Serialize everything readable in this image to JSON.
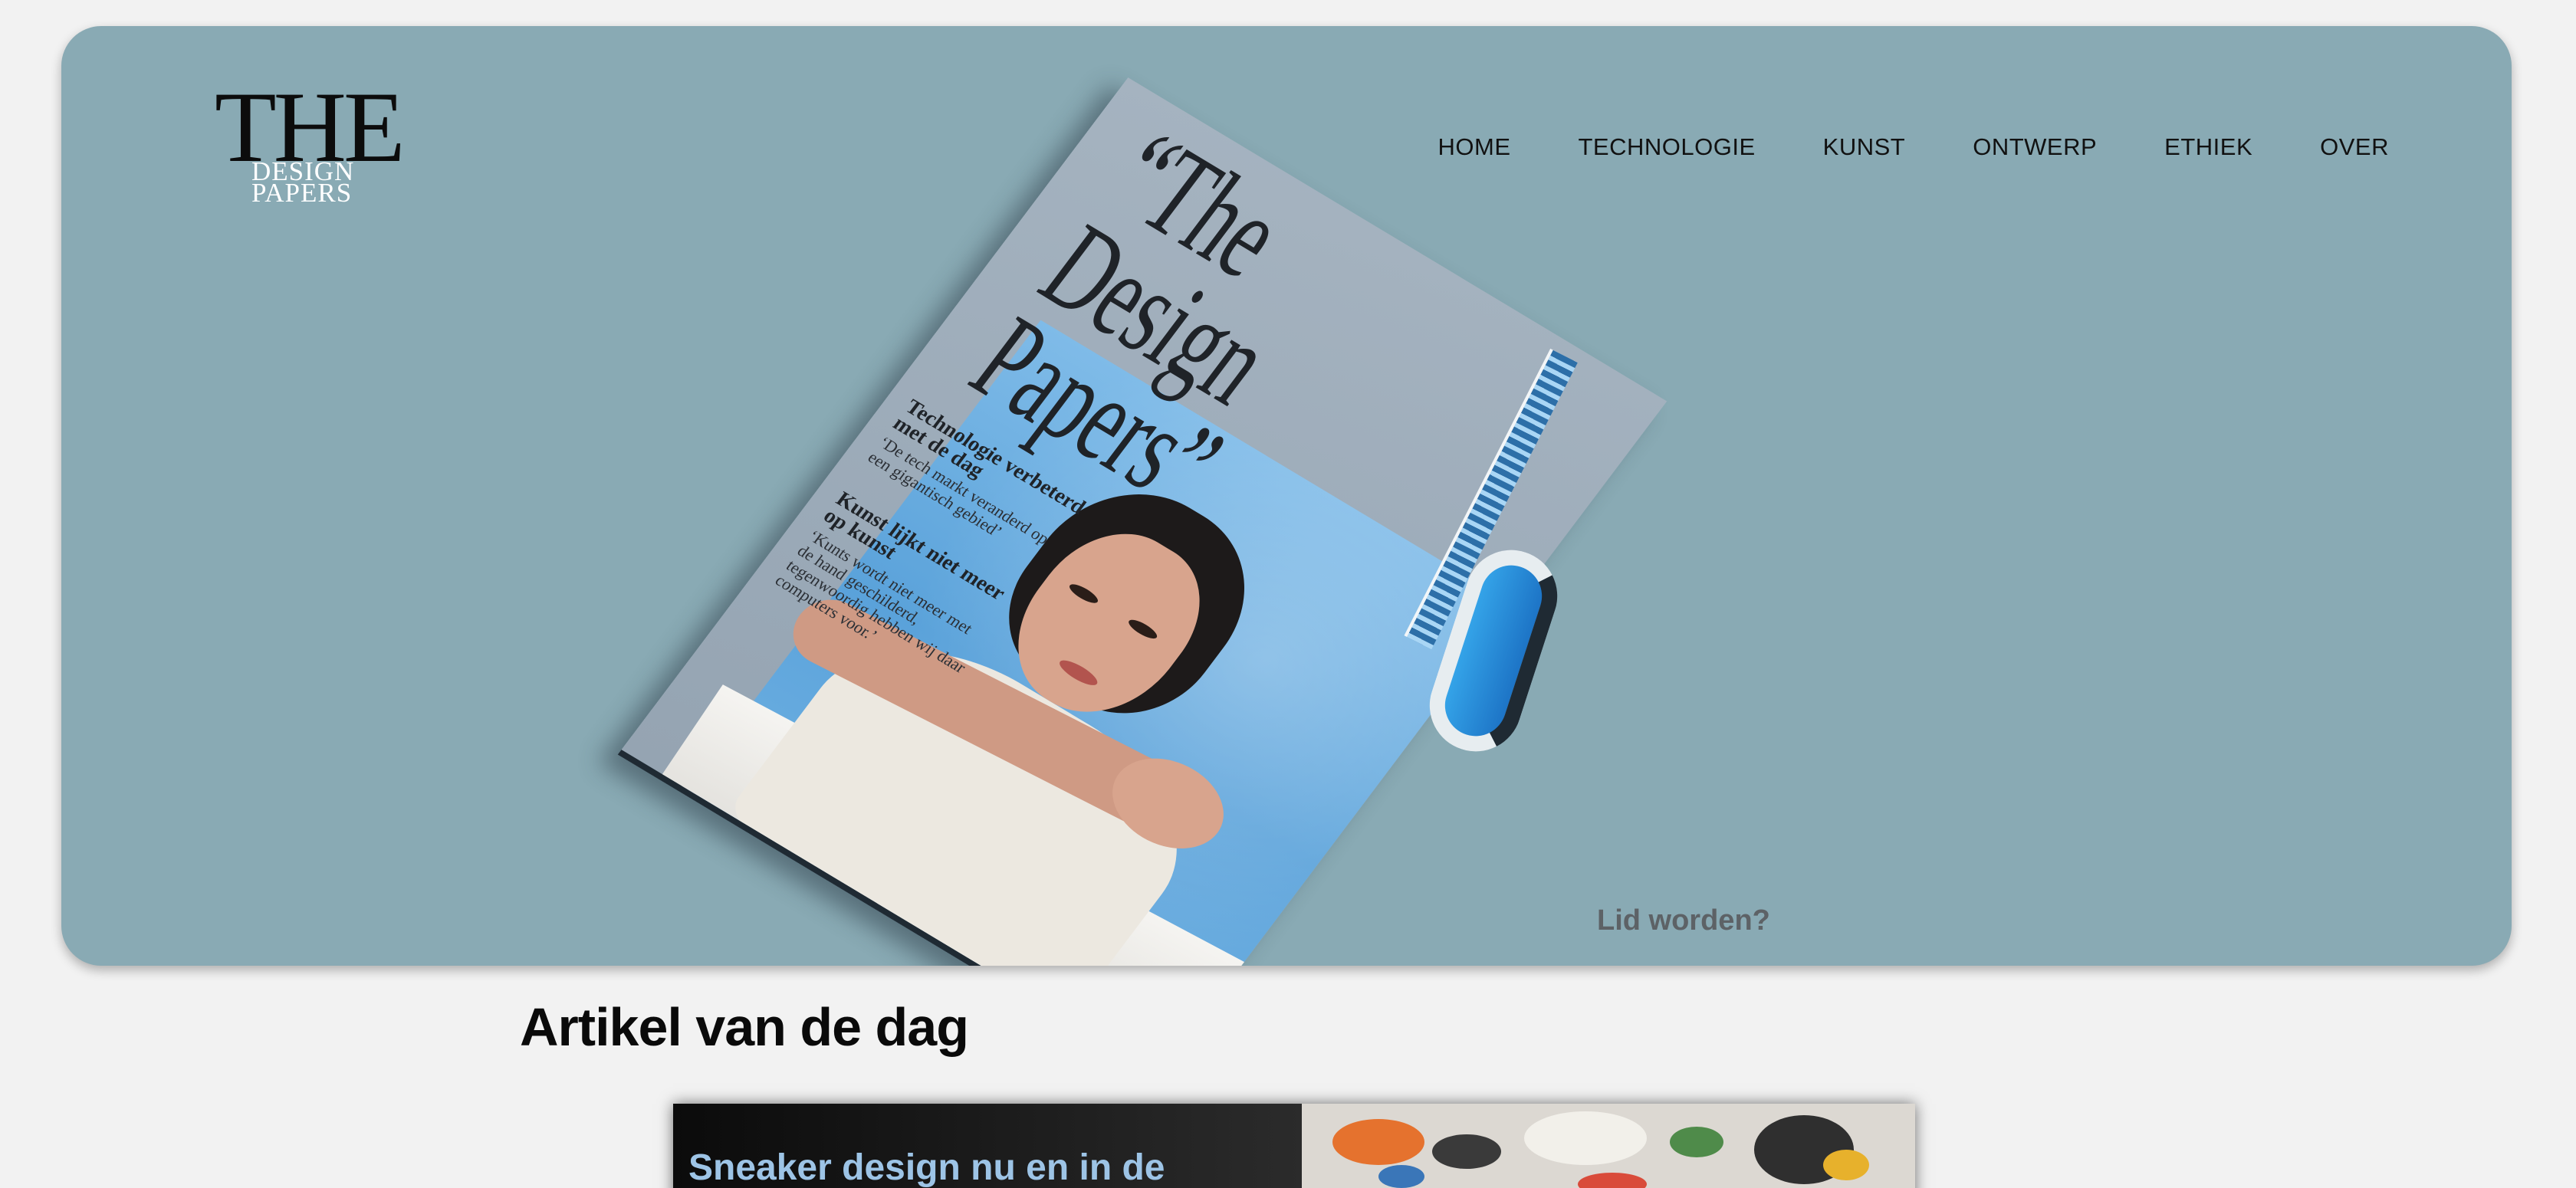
{
  "logo": {
    "the": "THE",
    "line1": "DESIGN",
    "line2": "PAPERS"
  },
  "nav": {
    "items": [
      "HOME",
      "TECHNOLOGIE",
      "KUNST",
      "ONTWERP",
      "ETHIEK",
      "OVER"
    ]
  },
  "magazine": {
    "title": "“The\nDesign\nPapers”",
    "headline1": "Technologie verbeterd\nmet de dag",
    "body1": "‘De tech markt veranderd op\neen gigantisch gebied’",
    "headline2": "Kunst lijkt niet meer\nop kunst",
    "body2": "‘Kunts wordt niet meer met\nde hand geschilderd,\ntegenwoordig hebben wij daar\ncomputers voor.’"
  },
  "hero": {
    "cta": "Lid worden?"
  },
  "section": {
    "title": "Artikel van de dag"
  },
  "article": {
    "title": "Sneaker design nu en in de"
  },
  "colors": {
    "hero_bg": "#89aab4",
    "page_bg": "#f2f2f2",
    "article_title": "#9dc4e6"
  }
}
